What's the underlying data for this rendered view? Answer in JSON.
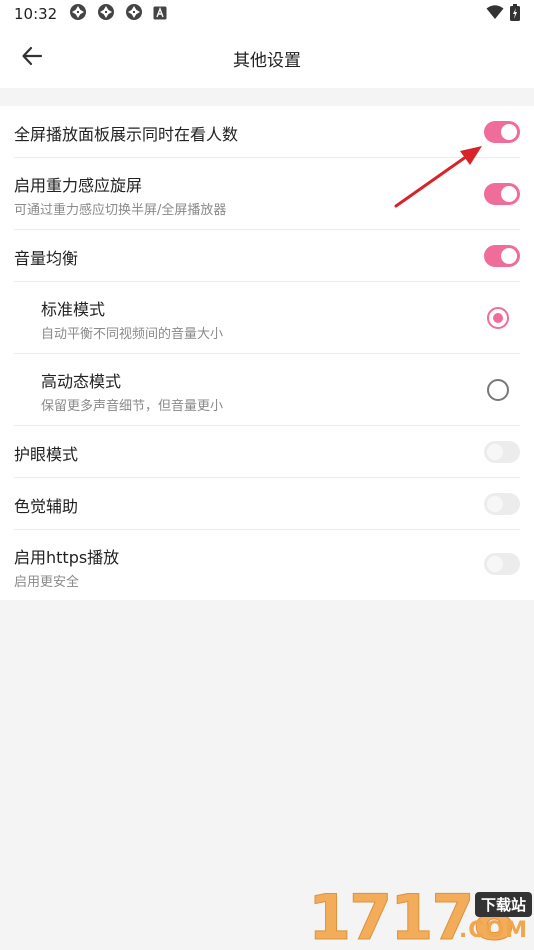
{
  "status_bar": {
    "time": "10:32",
    "left_icons": [
      "notification-aperture-icon",
      "notification-aperture-icon",
      "notification-aperture-icon",
      "notification-a-icon"
    ],
    "right_icons": [
      "wifi-icon",
      "battery-charging-icon"
    ]
  },
  "header": {
    "title": "其他设置",
    "back_icon": "arrow-left-icon"
  },
  "settings": [
    {
      "key": "fullscreen_panel_viewers",
      "label": "全屏播放面板展示同时在看人数",
      "sub": "",
      "control": "toggle",
      "on": true
    },
    {
      "key": "gravity_rotation",
      "label": "启用重力感应旋屏",
      "sub": "可通过重力感应切换半屏/全屏播放器",
      "control": "toggle",
      "on": true
    },
    {
      "key": "volume_balance",
      "label": "音量均衡",
      "sub": "",
      "control": "toggle",
      "on": true
    },
    {
      "key": "standard_mode",
      "label": "标准模式",
      "sub": "自动平衡不同视频间的音量大小",
      "control": "radio",
      "on": true
    },
    {
      "key": "dynamic_mode",
      "label": "高动态模式",
      "sub": "保留更多声音细节，但音量更小",
      "control": "radio",
      "on": false
    },
    {
      "key": "eye_care",
      "label": "护眼模式",
      "sub": "",
      "control": "toggle",
      "on": false
    },
    {
      "key": "color_assist",
      "label": "色觉辅助",
      "sub": "",
      "control": "toggle",
      "on": false
    },
    {
      "key": "https_playback",
      "label": "启用https播放",
      "sub": "启用更安全",
      "control": "toggle",
      "on": false
    }
  ],
  "watermark": {
    "digits": "17178",
    "badge": "下载站",
    "domain": ".COM"
  },
  "colors": {
    "accent": "#f06d99",
    "annotation_arrow": "#d8232a",
    "page_background": "#f4f4f4"
  }
}
